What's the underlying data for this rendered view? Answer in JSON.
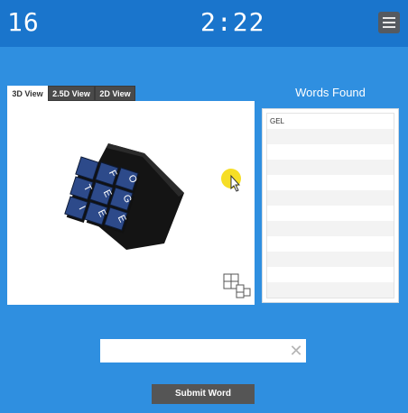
{
  "header": {
    "score": "16",
    "timer": "2:22",
    "menu_icon": "hamburger-menu-icon"
  },
  "view_tabs": [
    {
      "label": "3D View",
      "active": true
    },
    {
      "label": "2.5D View",
      "active": false
    },
    {
      "label": "2D View",
      "active": false
    }
  ],
  "cube": {
    "front_face": [
      "T",
      "I",
      "E",
      "E",
      "F",
      "G",
      "E",
      "O"
    ],
    "top_face": [
      "L"
    ],
    "cube_color": "#2d4a8a",
    "cube_view_icon": "cube-stack-icon",
    "cursor_highlight_color": "#f2d600"
  },
  "words": {
    "title": "Words Found",
    "found": [
      "GEL"
    ]
  },
  "input": {
    "value": "",
    "clear_icon": "close-x-icon",
    "clear_label": "✕"
  },
  "submit": {
    "label": "Submit Word"
  },
  "colors": {
    "background": "#2f8fe0",
    "topbar": "#1a75cc",
    "button": "#555555"
  }
}
